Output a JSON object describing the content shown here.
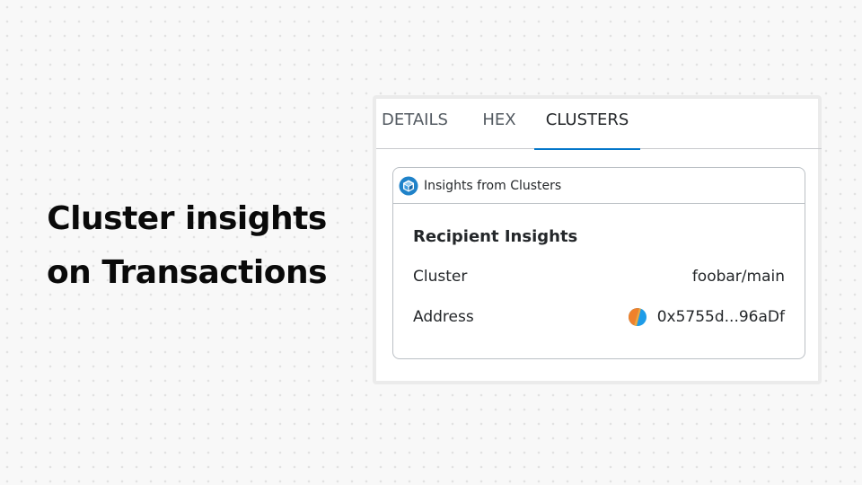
{
  "headline": {
    "line1": "Cluster insights",
    "line2": "on Transactions"
  },
  "tabs": [
    {
      "label": "DETAILS",
      "active": false
    },
    {
      "label": "HEX",
      "active": false
    },
    {
      "label": "CLUSTERS",
      "active": true
    }
  ],
  "card": {
    "header_icon": "cube-icon",
    "header_label": "Insights from Clusters",
    "section_title": "Recipient Insights",
    "rows": [
      {
        "label": "Cluster",
        "value": "foobar/main"
      },
      {
        "label": "Address",
        "value": "0x5755d...96aDf",
        "icon": "identicon"
      }
    ]
  },
  "colors": {
    "accent": "#0376c9",
    "text": "#24272a",
    "border": "#bbc0c5",
    "background": "#f8f8f8",
    "identicon_orange": "#f0812b",
    "identicon_blue": "#1e9ce8"
  }
}
